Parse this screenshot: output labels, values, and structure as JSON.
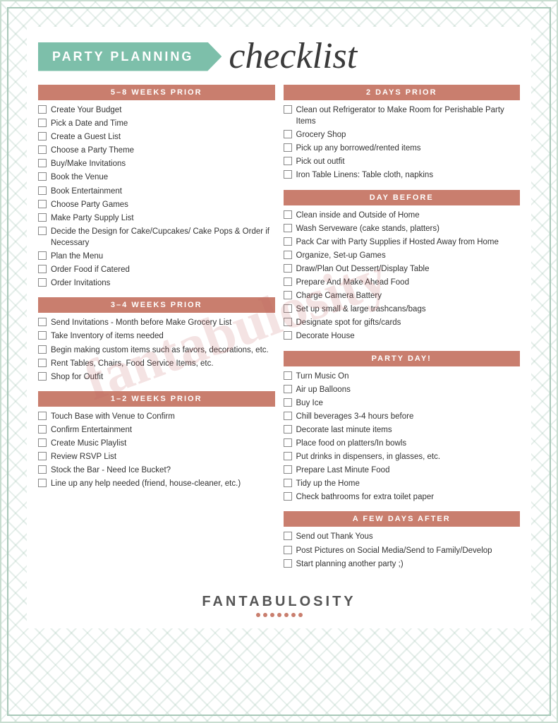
{
  "header": {
    "banner_text": "PARTY PLANNING",
    "title": "checklist"
  },
  "sections": {
    "left": [
      {
        "id": "5-8-weeks",
        "header": "5–8 WEEKS PRIOR",
        "items": [
          "Create Your Budget",
          "Pick a Date and Time",
          "Create a Guest List",
          "Choose a Party Theme",
          "Buy/Make Invitations",
          "Book the Venue",
          "Book Entertainment",
          "Choose Party Games",
          "Make Party Supply List",
          "Decide the Design for Cake/Cupcakes/ Cake Pops & Order if Necessary",
          "Plan the Menu",
          "Order Food if Catered",
          "Order Invitations"
        ]
      },
      {
        "id": "3-4-weeks",
        "header": "3–4 WEEKS PRIOR",
        "items": [
          "Send Invitations - Month before Make Grocery List",
          "Take Inventory of items needed",
          "Begin making custom items such as favors, decorations, etc.",
          "Rent Tables, Chairs, Food Service Items, etc.",
          "Shop for Outfit"
        ]
      },
      {
        "id": "1-2-weeks",
        "header": "1–2 WEEKS PRIOR",
        "items": [
          "Touch Base with Venue to Confirm",
          "Confirm Entertainment",
          "Create Music Playlist",
          "Review RSVP List",
          "Stock the Bar - Need Ice Bucket?",
          "Line up any help needed (friend, house-cleaner, etc.)"
        ]
      }
    ],
    "right": [
      {
        "id": "2-days",
        "header": "2 DAYS PRIOR",
        "items": [
          "Clean out Refrigerator to Make Room for Perishable Party Items",
          "Grocery Shop",
          "Pick up any borrowed/rented items",
          "Pick out outfit",
          "Iron Table Linens: Table cloth, napkins"
        ]
      },
      {
        "id": "day-before",
        "header": "DAY BEFORE",
        "items": [
          "Clean inside and Outside of Home",
          "Wash Serveware (cake stands, platters)",
          "Pack Car with Party Supplies if Hosted Away from Home",
          "Organize, Set-up Games",
          "Draw/Plan Out Dessert/Display Table",
          "Prepare And Make Ahead Food",
          "Charge Camera Battery",
          "Set up small & large trashcans/bags",
          "Designate spot for gifts/cards",
          "Decorate House"
        ]
      },
      {
        "id": "party-day",
        "header": "PARTY DAY!",
        "items": [
          "Turn Music On",
          "Air up Balloons",
          "Buy Ice",
          "Chill beverages 3-4 hours before",
          "Decorate last minute items",
          "Place food on platters/In bowls",
          "Put drinks in dispensers, in glasses, etc.",
          "Prepare Last Minute Food",
          "Tidy up the Home",
          "Check bathrooms for extra toilet paper"
        ]
      },
      {
        "id": "few-days-after",
        "header": "A FEW DAYS AFTER",
        "items": [
          "Send out Thank Yous",
          "Post Pictures on Social Media/Send to Family/Develop",
          "Start planning another party ;)"
        ]
      }
    ]
  },
  "watermark": "fantabulosity",
  "footer": {
    "brand": "FANTABULOSITY"
  }
}
